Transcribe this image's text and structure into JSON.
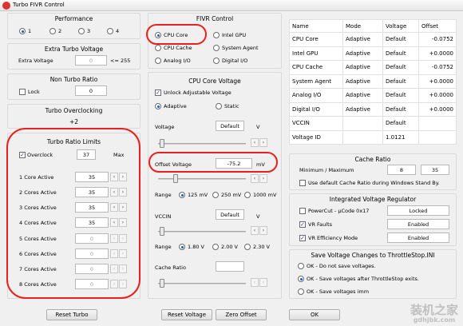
{
  "window": {
    "title": "Turbo FIVR Control"
  },
  "performance": {
    "title": "Performance",
    "options": [
      "1",
      "2",
      "3",
      "4"
    ],
    "selected": "1"
  },
  "extra_turbo": {
    "title": "Extra Turbo Voltage",
    "label": "Extra Voltage",
    "value": "0",
    "limit": "<= 255"
  },
  "non_turbo": {
    "title": "Non Turbo Ratio",
    "lock_label": "Lock",
    "value": "0"
  },
  "turbo_overclocking": {
    "title": "Turbo Overclocking",
    "value": "+2"
  },
  "turbo_ratio": {
    "title": "Turbo Ratio Limits",
    "overclock_label": "Overclock",
    "overclock_value": "37",
    "max_label": "Max",
    "rows": [
      {
        "label": "1 Core Active",
        "value": "35"
      },
      {
        "label": "2 Cores Active",
        "value": "35"
      },
      {
        "label": "3 Cores Active",
        "value": "35"
      },
      {
        "label": "4 Cores Active",
        "value": "35"
      },
      {
        "label": "5 Cores Active",
        "value": "0"
      },
      {
        "label": "6 Cores Active",
        "value": "0"
      },
      {
        "label": "7 Cores Active",
        "value": "0"
      },
      {
        "label": "8 Cores Active",
        "value": "0"
      }
    ]
  },
  "fivr_control": {
    "title": "FIVR Control",
    "options": [
      "CPU Core",
      "Intel GPU",
      "CPU Cache",
      "System Agent",
      "Analog I/O",
      "Digital I/O"
    ],
    "selected": "CPU Core"
  },
  "cpu_core_voltage": {
    "title": "CPU Core Voltage",
    "unlock_label": "Unlock Adjustable Voltage",
    "adaptive_label": "Adaptive",
    "static_label": "Static",
    "voltage_label": "Voltage",
    "voltage_value": "Default",
    "voltage_unit": "V",
    "offset_label": "Offset Voltage",
    "offset_value": "-75.2",
    "offset_unit": "mV",
    "range_label": "Range",
    "range_options": [
      "125 mV",
      "250 mV",
      "1000 mV"
    ],
    "range_selected": "125 mV",
    "vccin_label": "VCCIN",
    "vccin_value": "Default",
    "vccin_unit": "V",
    "vccin_range_options": [
      "1.80 V",
      "2.00 V",
      "2.30 V"
    ],
    "vccin_range_selected": "1.80 V",
    "cache_ratio_label": "Cache Ratio"
  },
  "voltage_table": {
    "headers": [
      "Name",
      "Mode",
      "Voltage",
      "Offset"
    ],
    "rows": [
      [
        "CPU Core",
        "Adaptive",
        "Default",
        "-0.0752"
      ],
      [
        "Intel GPU",
        "Adaptive",
        "Default",
        "+0.0000"
      ],
      [
        "CPU Cache",
        "Adaptive",
        "Default",
        "-0.0752"
      ],
      [
        "System Agent",
        "Adaptive",
        "Default",
        "+0.0000"
      ],
      [
        "Analog I/O",
        "Adaptive",
        "Default",
        "+0.0000"
      ],
      [
        "Digital I/O",
        "Adaptive",
        "Default",
        "+0.0000"
      ],
      [
        "VCCIN",
        "",
        "Default",
        ""
      ],
      [
        "Voltage ID",
        "",
        "1.0121",
        ""
      ]
    ]
  },
  "cache_ratio": {
    "title": "Cache Ratio",
    "label": "Minimum / Maximum",
    "min": "8",
    "max": "35",
    "default_label": "Use default Cache Ratio during Windows Stand By."
  },
  "ivr": {
    "title": "Integrated Voltage Regulator",
    "items": [
      {
        "label": "PowerCut  -  µCode 0x17",
        "checked": false,
        "status": "Locked"
      },
      {
        "label": "VR Faults",
        "checked": true,
        "status": "Enabled"
      },
      {
        "label": "VR Efficiency Mode",
        "checked": true,
        "status": "Enabled"
      }
    ]
  },
  "save_voltage": {
    "title": "Save Voltage Changes to ThrottleStop.INI",
    "options": [
      "OK - Do not save voltages.",
      "OK - Save voltages after ThrottleStop exits.",
      "OK - Save voltages imm"
    ],
    "selected_index": 1
  },
  "buttons": {
    "reset_turbo": "Reset Turbo",
    "reset_voltage": "Reset Voltage",
    "zero_offset": "Zero Offset",
    "ok": "OK"
  },
  "watermark": {
    "text": "装机之家",
    "url": "gdhjbk.com"
  },
  "colors": {
    "annotation_red": "#e8201e",
    "accent_blue": "#1a5fb4"
  }
}
